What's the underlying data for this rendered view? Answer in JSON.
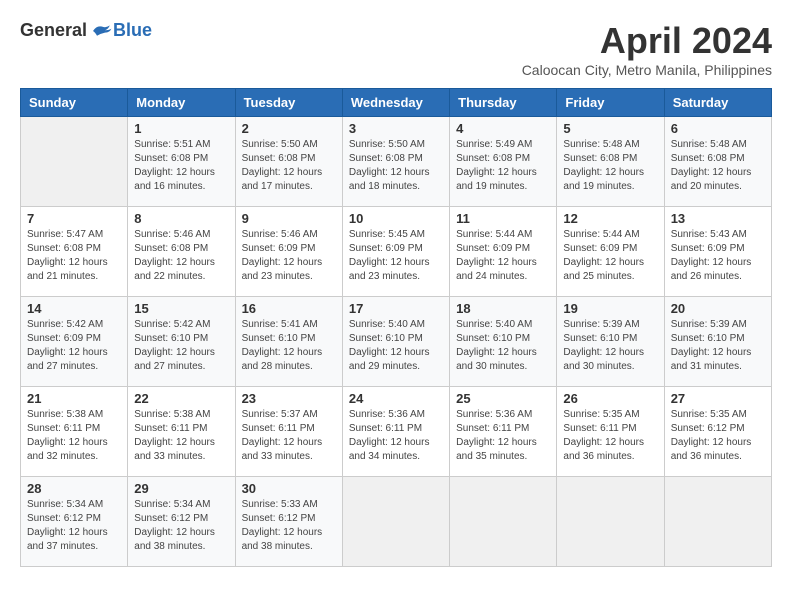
{
  "logo": {
    "general": "General",
    "blue": "Blue"
  },
  "title": "April 2024",
  "location": "Caloocan City, Metro Manila, Philippines",
  "days_of_week": [
    "Sunday",
    "Monday",
    "Tuesday",
    "Wednesday",
    "Thursday",
    "Friday",
    "Saturday"
  ],
  "weeks": [
    [
      {
        "day": "",
        "sunrise": "",
        "sunset": "",
        "daylight": "",
        "empty": true
      },
      {
        "day": "1",
        "sunrise": "5:51 AM",
        "sunset": "6:08 PM",
        "daylight": "12 hours and 16 minutes."
      },
      {
        "day": "2",
        "sunrise": "5:50 AM",
        "sunset": "6:08 PM",
        "daylight": "12 hours and 17 minutes."
      },
      {
        "day": "3",
        "sunrise": "5:50 AM",
        "sunset": "6:08 PM",
        "daylight": "12 hours and 18 minutes."
      },
      {
        "day": "4",
        "sunrise": "5:49 AM",
        "sunset": "6:08 PM",
        "daylight": "12 hours and 19 minutes."
      },
      {
        "day": "5",
        "sunrise": "5:48 AM",
        "sunset": "6:08 PM",
        "daylight": "12 hours and 19 minutes."
      },
      {
        "day": "6",
        "sunrise": "5:48 AM",
        "sunset": "6:08 PM",
        "daylight": "12 hours and 20 minutes."
      }
    ],
    [
      {
        "day": "7",
        "sunrise": "5:47 AM",
        "sunset": "6:08 PM",
        "daylight": "12 hours and 21 minutes."
      },
      {
        "day": "8",
        "sunrise": "5:46 AM",
        "sunset": "6:08 PM",
        "daylight": "12 hours and 22 minutes."
      },
      {
        "day": "9",
        "sunrise": "5:46 AM",
        "sunset": "6:09 PM",
        "daylight": "12 hours and 23 minutes."
      },
      {
        "day": "10",
        "sunrise": "5:45 AM",
        "sunset": "6:09 PM",
        "daylight": "12 hours and 23 minutes."
      },
      {
        "day": "11",
        "sunrise": "5:44 AM",
        "sunset": "6:09 PM",
        "daylight": "12 hours and 24 minutes."
      },
      {
        "day": "12",
        "sunrise": "5:44 AM",
        "sunset": "6:09 PM",
        "daylight": "12 hours and 25 minutes."
      },
      {
        "day": "13",
        "sunrise": "5:43 AM",
        "sunset": "6:09 PM",
        "daylight": "12 hours and 26 minutes."
      }
    ],
    [
      {
        "day": "14",
        "sunrise": "5:42 AM",
        "sunset": "6:09 PM",
        "daylight": "12 hours and 27 minutes."
      },
      {
        "day": "15",
        "sunrise": "5:42 AM",
        "sunset": "6:10 PM",
        "daylight": "12 hours and 27 minutes."
      },
      {
        "day": "16",
        "sunrise": "5:41 AM",
        "sunset": "6:10 PM",
        "daylight": "12 hours and 28 minutes."
      },
      {
        "day": "17",
        "sunrise": "5:40 AM",
        "sunset": "6:10 PM",
        "daylight": "12 hours and 29 minutes."
      },
      {
        "day": "18",
        "sunrise": "5:40 AM",
        "sunset": "6:10 PM",
        "daylight": "12 hours and 30 minutes."
      },
      {
        "day": "19",
        "sunrise": "5:39 AM",
        "sunset": "6:10 PM",
        "daylight": "12 hours and 30 minutes."
      },
      {
        "day": "20",
        "sunrise": "5:39 AM",
        "sunset": "6:10 PM",
        "daylight": "12 hours and 31 minutes."
      }
    ],
    [
      {
        "day": "21",
        "sunrise": "5:38 AM",
        "sunset": "6:11 PM",
        "daylight": "12 hours and 32 minutes."
      },
      {
        "day": "22",
        "sunrise": "5:38 AM",
        "sunset": "6:11 PM",
        "daylight": "12 hours and 33 minutes."
      },
      {
        "day": "23",
        "sunrise": "5:37 AM",
        "sunset": "6:11 PM",
        "daylight": "12 hours and 33 minutes."
      },
      {
        "day": "24",
        "sunrise": "5:36 AM",
        "sunset": "6:11 PM",
        "daylight": "12 hours and 34 minutes."
      },
      {
        "day": "25",
        "sunrise": "5:36 AM",
        "sunset": "6:11 PM",
        "daylight": "12 hours and 35 minutes."
      },
      {
        "day": "26",
        "sunrise": "5:35 AM",
        "sunset": "6:11 PM",
        "daylight": "12 hours and 36 minutes."
      },
      {
        "day": "27",
        "sunrise": "5:35 AM",
        "sunset": "6:12 PM",
        "daylight": "12 hours and 36 minutes."
      }
    ],
    [
      {
        "day": "28",
        "sunrise": "5:34 AM",
        "sunset": "6:12 PM",
        "daylight": "12 hours and 37 minutes."
      },
      {
        "day": "29",
        "sunrise": "5:34 AM",
        "sunset": "6:12 PM",
        "daylight": "12 hours and 38 minutes."
      },
      {
        "day": "30",
        "sunrise": "5:33 AM",
        "sunset": "6:12 PM",
        "daylight": "12 hours and 38 minutes."
      },
      {
        "day": "",
        "sunrise": "",
        "sunset": "",
        "daylight": "",
        "empty": true
      },
      {
        "day": "",
        "sunrise": "",
        "sunset": "",
        "daylight": "",
        "empty": true
      },
      {
        "day": "",
        "sunrise": "",
        "sunset": "",
        "daylight": "",
        "empty": true
      },
      {
        "day": "",
        "sunrise": "",
        "sunset": "",
        "daylight": "",
        "empty": true
      }
    ]
  ],
  "labels": {
    "sunrise": "Sunrise:",
    "sunset": "Sunset:",
    "daylight": "Daylight:"
  }
}
